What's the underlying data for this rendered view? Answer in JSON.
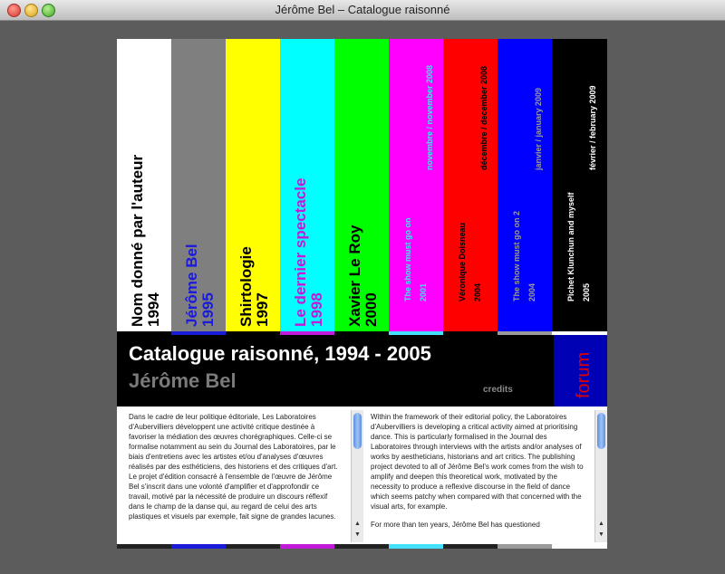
{
  "window": {
    "title": "Jérôme Bel – Catalogue raisonné"
  },
  "bars": [
    {
      "color": "#ffffff",
      "text_color": "#000000",
      "label": "Nom donné par l'auteur",
      "year": "1994",
      "small": false
    },
    {
      "color": "#7f7f7f",
      "text_color": "#1a1ad9",
      "label": "Jérôme Bel",
      "year": "1995",
      "small": false
    },
    {
      "color": "#ffff00",
      "text_color": "#000000",
      "label": "Shirtologie",
      "year": "1997",
      "small": false
    },
    {
      "color": "#00ffff",
      "text_color": "#c21ad9",
      "label": "Le dernier spectacle",
      "year": "1998",
      "small": false
    },
    {
      "color": "#00ff00",
      "text_color": "#000000",
      "label": "Xavier Le Roy",
      "year": "2000",
      "small": false
    },
    {
      "color": "#ff00ff",
      "text_color": "#44e0ff",
      "label": "The show must go on",
      "year": "2001",
      "date": "novembre / november 2008",
      "small": true
    },
    {
      "color": "#ff0000",
      "text_color": "#000000",
      "label": "Véronique Doisneau",
      "year": "2004",
      "date": "décembre / december 2008",
      "small": true
    },
    {
      "color": "#0000ff",
      "text_color": "#9a9a9a",
      "label": "The show must go on 2",
      "year": "2004",
      "date": "janvier / january 2009",
      "small": true
    },
    {
      "color": "#000000",
      "text_color": "#ffffff",
      "label": "Pichet Klunchun and myself",
      "year": "2005",
      "date": "février / february 2009",
      "small": true
    }
  ],
  "header": {
    "catalogue_title": "Catalogue raisonné, 1994 - 2005",
    "author": "Jérôme Bel",
    "credits": "credits",
    "forum": "forum"
  },
  "text_fr": [
    "Dans le cadre de leur politique éditoriale, Les Laboratoires d'Aubervilliers développent une activité critique destinée à favoriser la médiation des œuvres chorégraphiques. Celle-ci se formalise notamment au sein du Journal des Laboratoires, par le biais d'entretiens avec les artistes et/ou d'analyses d'œuvres réalisés par des esthéticiens, des historiens et des critiques d'art. Le projet d'édition consacré à l'ensemble de l'œuvre de Jérôme Bel s'inscrit dans une volonté d'amplifier et d'approfondir ce travail, motivé par la nécessité de produire un discours réflexif dans le champ de la danse qui, au regard de celui des arts plastiques et visuels par exemple, fait signe de grandes lacunes."
  ],
  "text_en": [
    "Within the framework of their editorial policy, the Laboratoires d'Aubervilliers is developing a critical activity aimed at prioritising dance. This is particularly formalised in the Journal des Laboratoires through interviews with the artists and/or analyses of works by aestheticians, historians and art critics. The publishing project devoted to all of Jérôme Bel's work comes from the wish to amplify and deepen this theoretical work, motivated by the necessity to produce a reflexive discourse in the field of dance which seems patchy when compared with that concerned with the visual arts, for example.",
    "For more than ten years, Jérôme Bel has questioned"
  ]
}
